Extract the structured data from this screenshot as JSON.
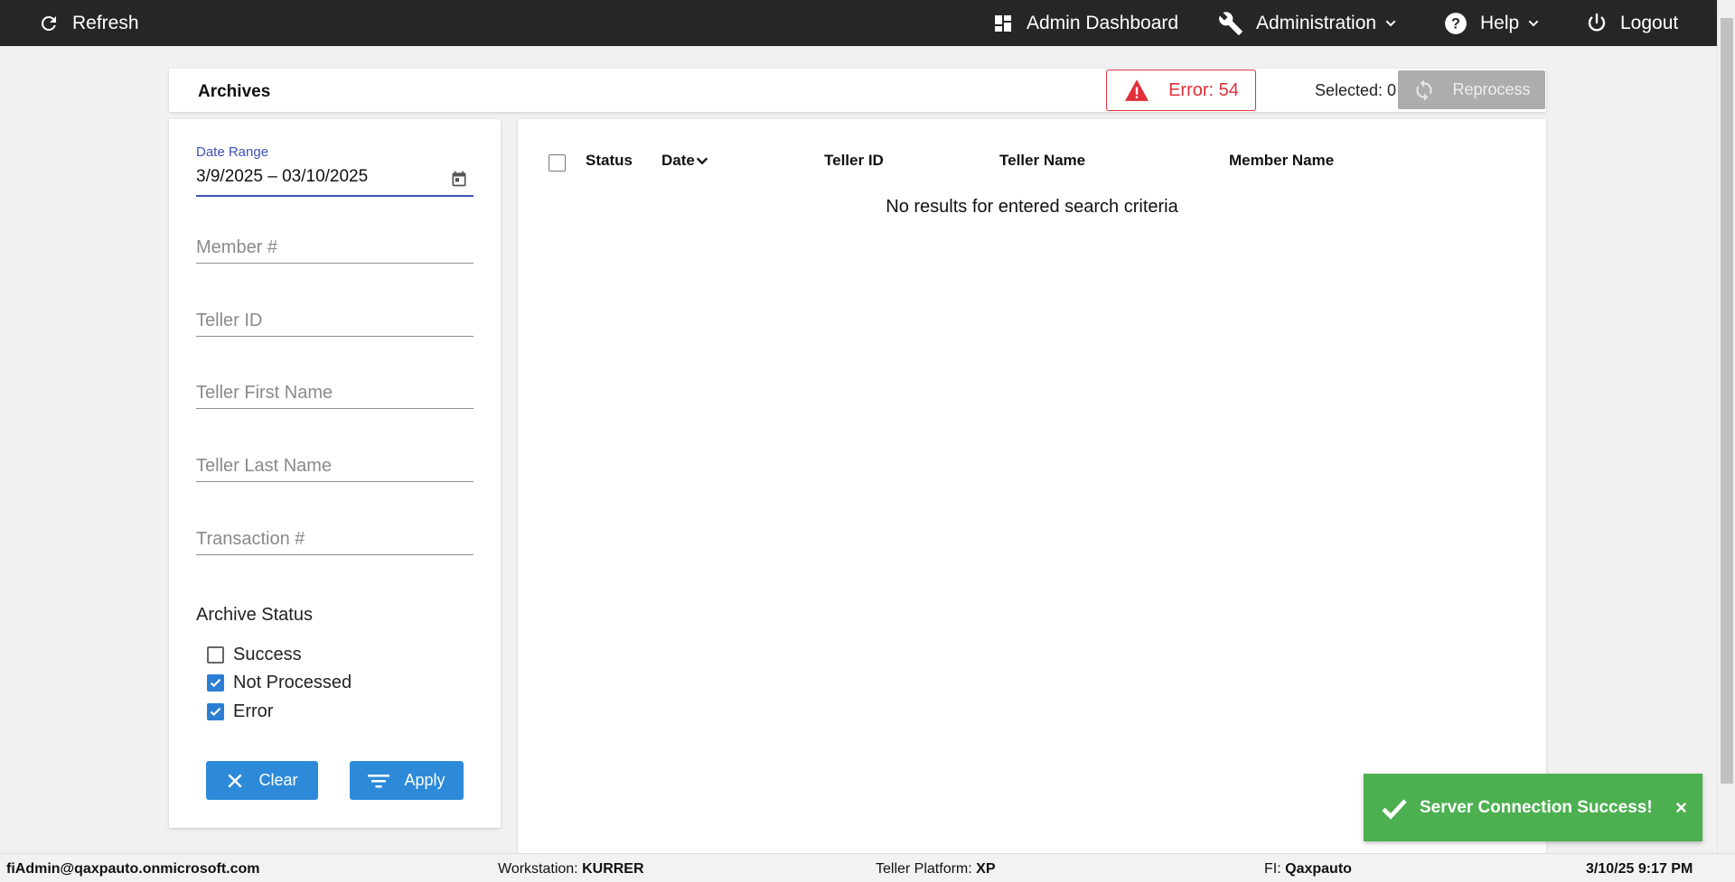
{
  "topbar": {
    "refresh": "Refresh",
    "admin_dashboard": "Admin Dashboard",
    "administration": "Administration",
    "help": "Help",
    "logout": "Logout"
  },
  "header": {
    "title": "Archives",
    "error_badge": "Error: 54",
    "selected": "Selected: 0",
    "reprocess": "Reprocess"
  },
  "filters": {
    "date_range_label": "Date Range",
    "date_range_value": "3/9/2025 – 03/10/2025",
    "member_placeholder": "Member #",
    "teller_id_placeholder": "Teller ID",
    "teller_first_placeholder": "Teller First Name",
    "teller_last_placeholder": "Teller Last Name",
    "transaction_placeholder": "Transaction #",
    "archive_status_title": "Archive Status",
    "statuses": [
      {
        "label": "Success",
        "checked": false
      },
      {
        "label": "Not Processed",
        "checked": true
      },
      {
        "label": "Error",
        "checked": true
      }
    ],
    "clear": "Clear",
    "apply": "Apply"
  },
  "table": {
    "columns": [
      "Status",
      "Date",
      "Teller ID",
      "Teller Name",
      "Member Name"
    ],
    "empty_message": "No results for entered search criteria"
  },
  "toast": {
    "message": "Server Connection Success!",
    "close": "×"
  },
  "statusbar": {
    "user": "fiAdmin@qaxpauto.onmicrosoft.com",
    "workstation_label": "Workstation:",
    "workstation_value": "KURRER",
    "platform_label": "Teller Platform:",
    "platform_value": "XP",
    "fi_label": "FI:",
    "fi_value": "Qaxpauto",
    "datetime": "3/10/25 9:17 PM"
  },
  "colors": {
    "topbar_bg": "#262626",
    "accent_blue": "#2d8ad9",
    "focus_indigo": "#3f51b5",
    "error_red": "#e0303a",
    "toast_green": "#4caf50"
  }
}
